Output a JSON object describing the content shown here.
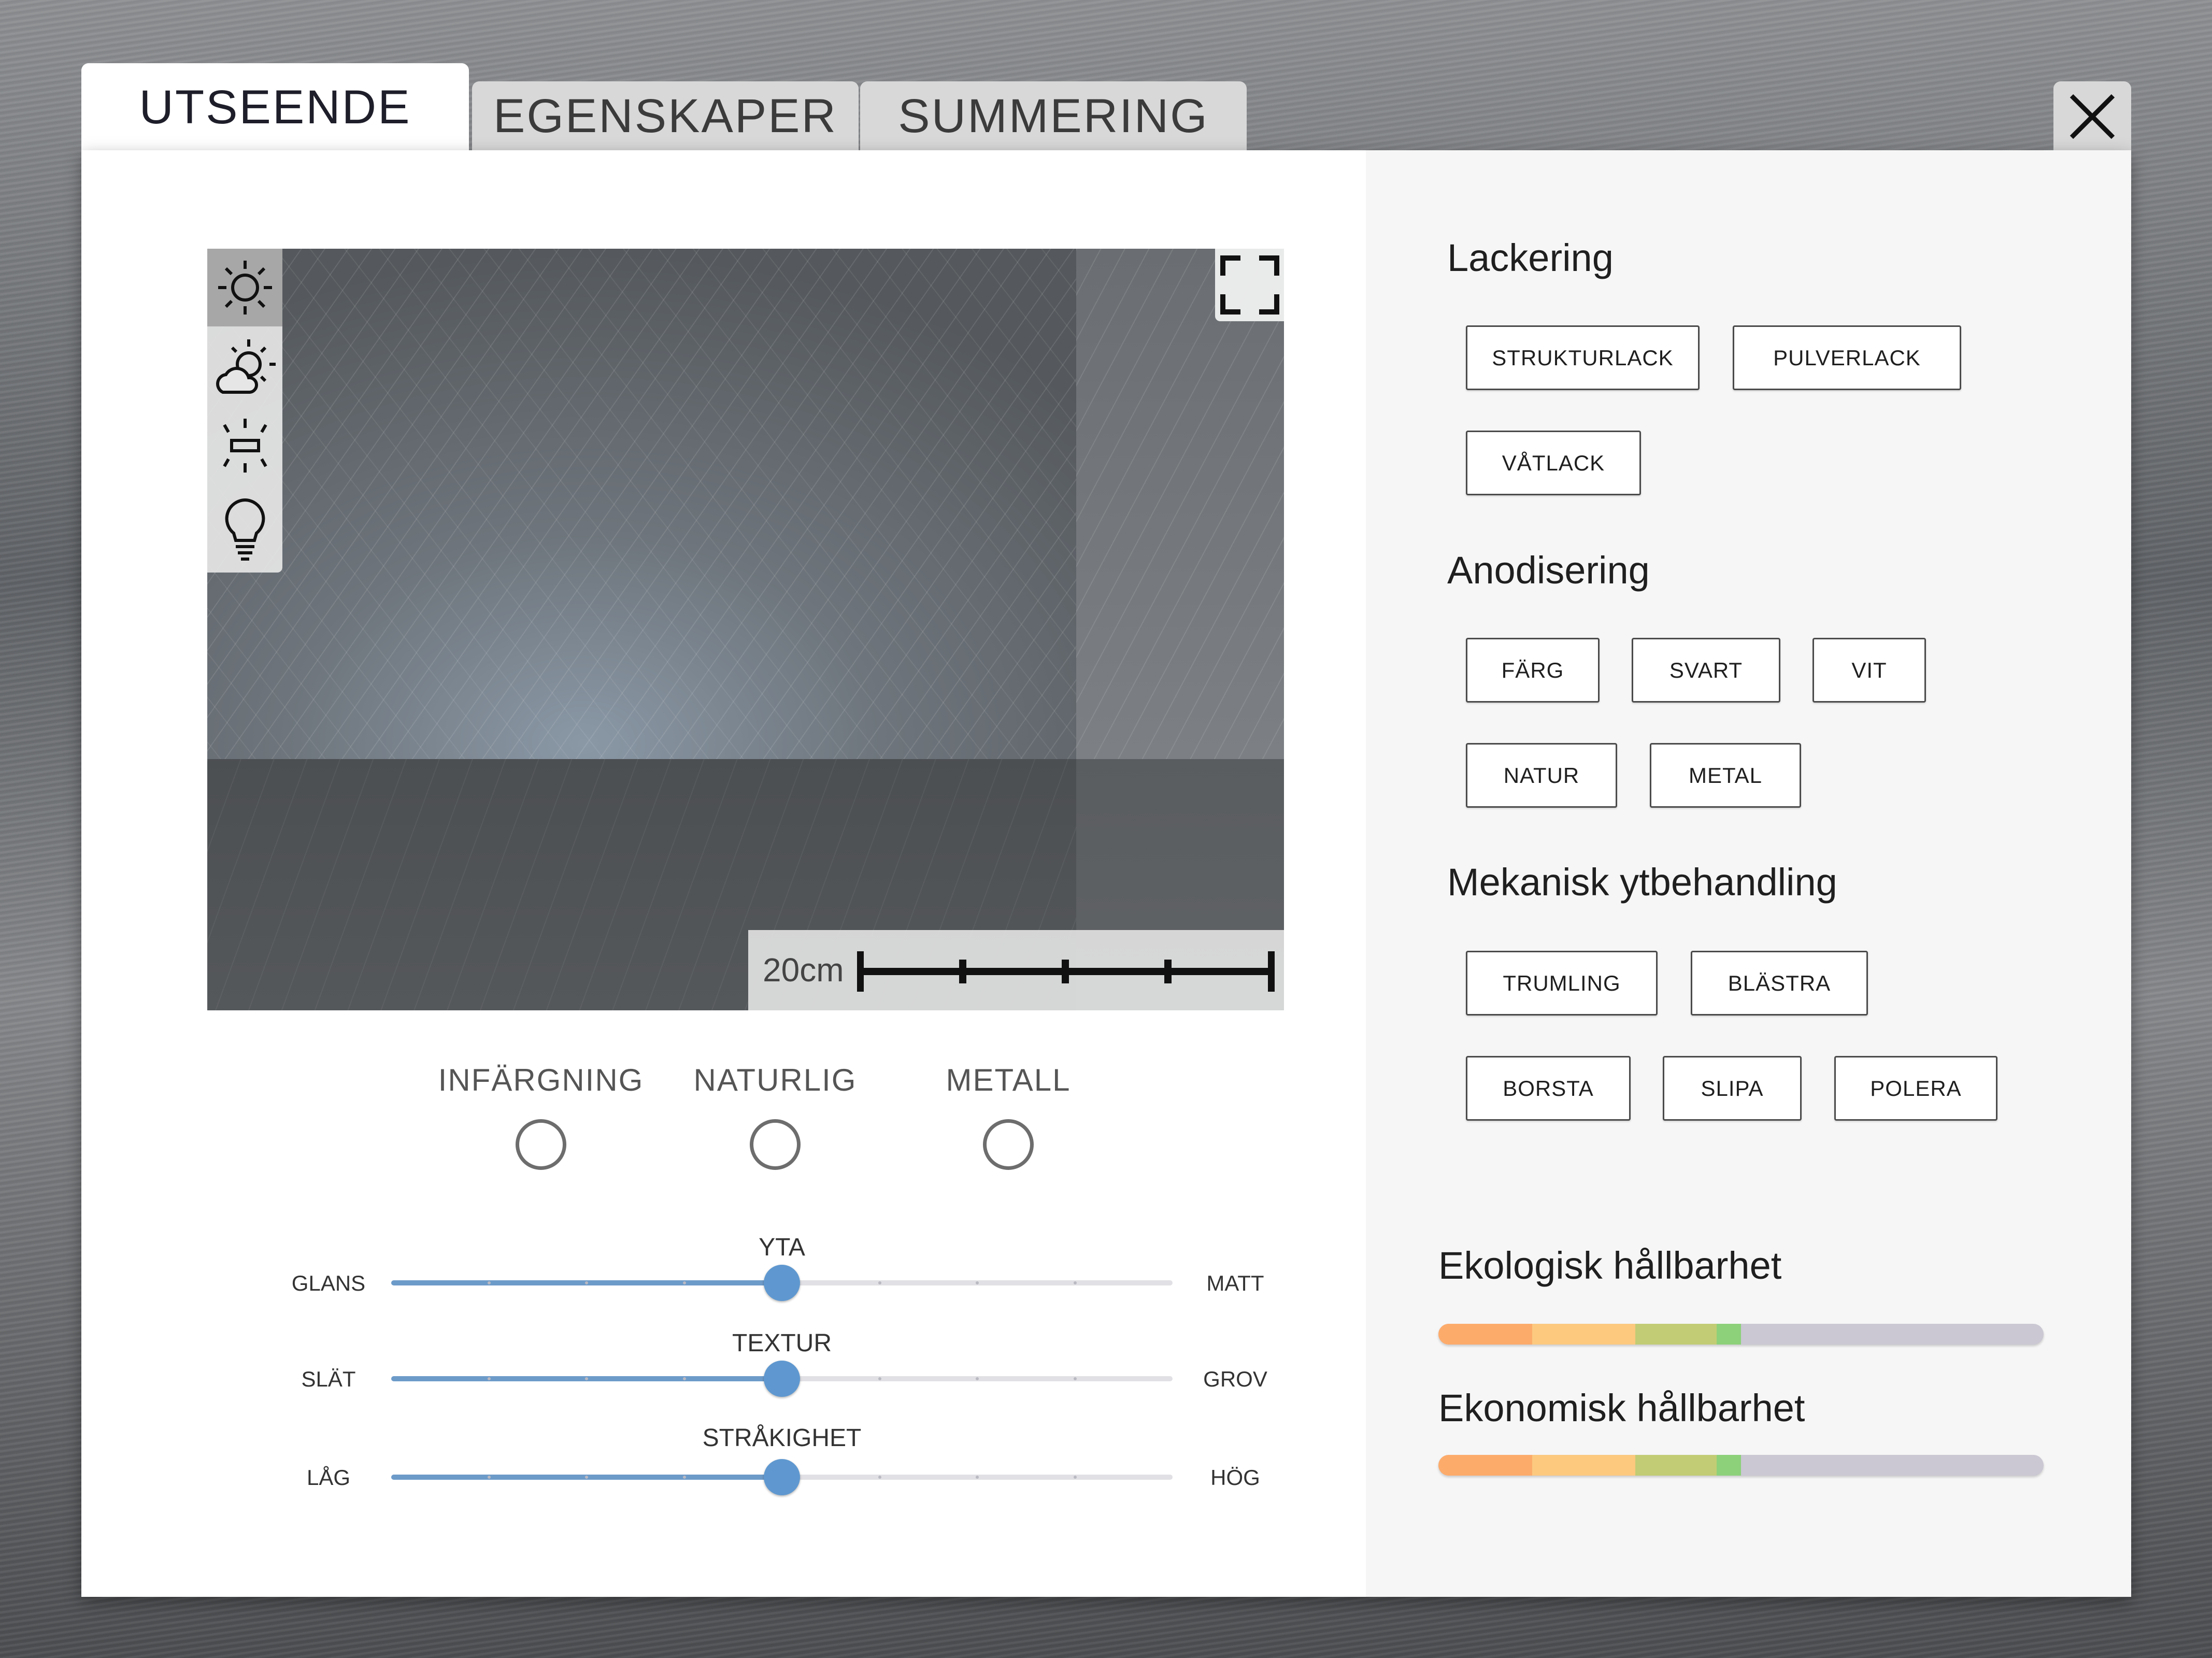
{
  "tabs": [
    {
      "label": "UTSEENDE",
      "active": true
    },
    {
      "label": "EGENSKAPER",
      "active": false
    },
    {
      "label": "SUMMERING",
      "active": false
    }
  ],
  "close_icon": "close-icon",
  "preview": {
    "lighting_icons": [
      "sun-icon",
      "partly-cloudy-icon",
      "lamp-icon",
      "lightbulb-icon"
    ],
    "selected_lighting": "sun-icon",
    "fullscreen_icon": "fullscreen-icon",
    "scale_label": "20cm"
  },
  "finish_options": [
    {
      "label": "INFÄRGNING",
      "selected": false
    },
    {
      "label": "NATURLIG",
      "selected": false
    },
    {
      "label": "METALL",
      "selected": false
    }
  ],
  "sliders": [
    {
      "title": "YTA",
      "min_label": "GLANS",
      "max_label": "MATT",
      "value_percent": 50
    },
    {
      "title": "TEXTUR",
      "min_label": "SLÄT",
      "max_label": "GROV",
      "value_percent": 50
    },
    {
      "title": "STRÅKIGHET",
      "min_label": "LÅG",
      "max_label": "HÖG",
      "value_percent": 50
    }
  ],
  "sections": [
    {
      "title": "Lackering",
      "options": [
        "STRUKTURLACK",
        "PULVERLACK",
        "VÅTLACK"
      ]
    },
    {
      "title": "Anodisering",
      "options": [
        "FÄRG",
        "SVART",
        "VIT",
        "NATUR",
        "METAL"
      ]
    },
    {
      "title": "Mekanisk ytbehandling",
      "options": [
        "TRUMLING",
        "BLÄSTRA",
        "BORSTA",
        "SLIPA",
        "POLERA"
      ]
    }
  ],
  "sustainability": [
    {
      "title": "Ekologisk hållbarhet",
      "value_percent": 50
    },
    {
      "title": "Ekonomisk hållbarhet",
      "value_percent": 50
    }
  ],
  "colors": {
    "accent_blue": "#5f98d0",
    "scale_orange": "#fdab6b",
    "scale_light_orange": "#fcc97f",
    "scale_olive": "#c2cc74",
    "scale_green": "#8dd17a",
    "track_gray": "#cbc7d3"
  }
}
